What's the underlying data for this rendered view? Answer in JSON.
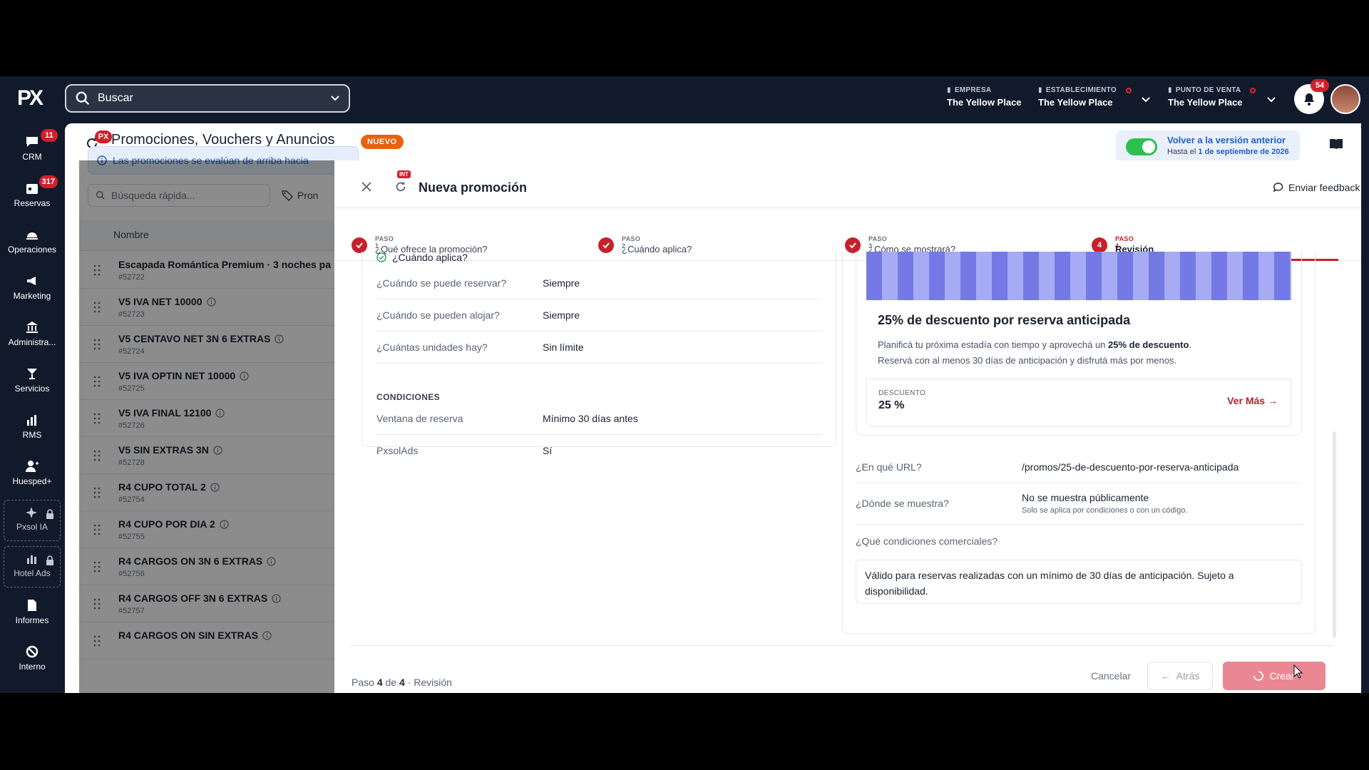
{
  "topbar": {
    "logo": "PX",
    "search_label": "Buscar",
    "empresa_label": "EMPRESA",
    "empresa_value": "The Yellow Place",
    "establecimiento_label": "ESTABLECIMIENTO",
    "establecimiento_value": "The Yellow Place",
    "punto_label": "PUNTO DE VENTA",
    "punto_value": "The Yellow Place",
    "notifications": "54"
  },
  "sidebar": {
    "items": [
      {
        "label": "CRM",
        "badge": "11"
      },
      {
        "label": "Reservas",
        "badge": "317"
      },
      {
        "label": "Operaciones"
      },
      {
        "label": "Marketing"
      },
      {
        "label": "Administra..."
      },
      {
        "label": "Servicios"
      },
      {
        "label": "RMS"
      },
      {
        "label": "Huesped+"
      },
      {
        "label": "Pxsol IA"
      },
      {
        "label": "Hotel Ads"
      },
      {
        "label": "Informes"
      },
      {
        "label": "Interno"
      }
    ]
  },
  "page": {
    "px_badge": "PX",
    "title": "Promociones, Vouchers y Anuncios",
    "new_badge": "NUEVO",
    "old_version_title": "Volver a la versión anterior",
    "old_version_prefix": "Hasta el ",
    "old_version_date": "1 de septiembre de 2026"
  },
  "list": {
    "info": "Las promociones se evalúan de arriba hacia",
    "quick_search_placeholder": "Búsqueda rápida...",
    "promo_filter": "Pron",
    "col_name": "Nombre",
    "rows": [
      {
        "name": "Escapada Romántica Premium · 3 noches pa",
        "id": "#52722"
      },
      {
        "name": "V5 IVA NET 10000",
        "id": "#52723"
      },
      {
        "name": "V5 CENTAVO NET 3N 6 EXTRAS",
        "id": "#52724"
      },
      {
        "name": "V5 IVA OPTIN NET 10000",
        "id": "#52725"
      },
      {
        "name": "V5 IVA FINAL 12100",
        "id": "#52726"
      },
      {
        "name": "V5 SIN EXTRAS 3N",
        "id": "#52728"
      },
      {
        "name": "R4 CUPO TOTAL 2",
        "id": "#52754"
      },
      {
        "name": "R4 CUPO POR DIA 2",
        "id": "#52755"
      },
      {
        "name": "R4 CARGOS ON 3N 6 EXTRAS",
        "id": "#52756"
      },
      {
        "name": "R4 CARGOS OFF 3N 6 EXTRAS",
        "id": "#52757"
      },
      {
        "name": "R4 CARGOS ON SIN EXTRAS",
        "id": ""
      }
    ]
  },
  "drawer": {
    "int_badge": "INT",
    "title": "Nueva promoción",
    "feedback": "Enviar feedback",
    "steps": [
      {
        "kicker": "PASO 1",
        "title": "¿Qué ofrece la promoción?"
      },
      {
        "kicker": "PASO 2",
        "title": "¿Cuándo aplica?"
      },
      {
        "kicker": "PASO 3",
        "title": "¿Cómo se mostrará?"
      },
      {
        "kicker": "PASO 4",
        "title": "Revisión",
        "number": "4"
      }
    ],
    "when_section": "¿Cuándo aplica?",
    "when_rows": [
      {
        "k": "¿Cuándo se puede reservar?",
        "v": "Siempre"
      },
      {
        "k": "¿Cuándo se pueden alojar?",
        "v": "Siempre"
      },
      {
        "k": "¿Cuántas unidades hay?",
        "v": "Sin límite"
      }
    ],
    "conditions_label": "CONDICIONES",
    "condition_rows": [
      {
        "k": "Ventana de reserva",
        "v": "Mínimo 30 días antes"
      },
      {
        "k": "PxsolAds",
        "v": "Sí"
      }
    ],
    "preview": {
      "title": "25% de descuento por reserva anticipada",
      "desc_1": "Planificá tu próxima estadía con tiempo y aprovechá un ",
      "desc_bold": "25% de descuento",
      "desc_2": ".",
      "desc_3": "Reservá con al menos 30 días de anticipación y disfrutá más por menos.",
      "discount_label": "DESCUENTO",
      "discount_value": "25 %",
      "more": "Ver Más"
    },
    "url_label": "¿En qué URL?",
    "url_value": "/promos/25-de-descuento-por-reserva-anticipada",
    "where_label": "¿Dónde se muestra?",
    "where_value": "No se muestra públicamente",
    "where_sub": "Solo se aplica por condiciones o con un código.",
    "terms_label": "¿Qué condiciones comerciales?",
    "terms_value": "Válido para reservas realizadas con un mínimo de 30 días de anticipación. Sujeto a disponibilidad.",
    "footer_prefix": "Paso ",
    "footer_current": "4",
    "footer_of": " de ",
    "footer_total": "4",
    "footer_sep": " · ",
    "footer_name": "Revisión",
    "cancel": "Cancelar",
    "back": "Atrás",
    "create": "Crear"
  },
  "colors": {
    "accent": "#c8202a",
    "topbar": "#111a2b",
    "toggle": "#2cc14e",
    "link": "#1f5fc6"
  }
}
